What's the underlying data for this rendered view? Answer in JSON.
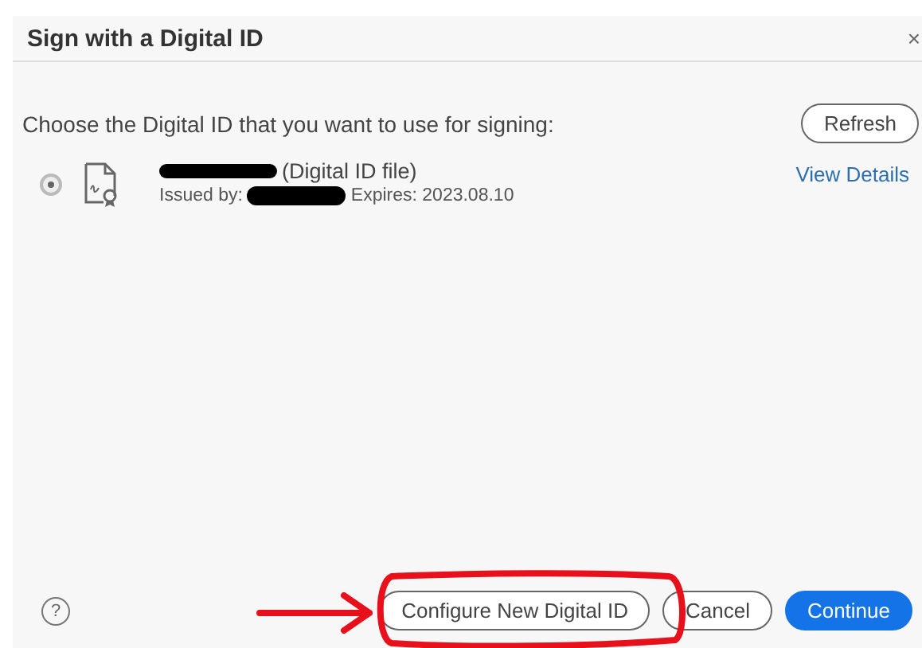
{
  "dialog": {
    "title": "Sign with a Digital ID",
    "close": "×"
  },
  "prompt": "Choose the Digital ID that you want to use for signing:",
  "refresh_button": "Refresh",
  "ids": [
    {
      "selected": true,
      "type_label": "(Digital ID file)",
      "issued_label": "Issued by:",
      "expires": "Expires: 2023.08.10",
      "details_link": "View Details"
    }
  ],
  "footer": {
    "help": "?",
    "buttons": [
      {
        "label": "Configure New Digital ID",
        "kind": "outline"
      },
      {
        "label": "Cancel",
        "kind": "outline"
      },
      {
        "label": "Continue",
        "kind": "primary"
      }
    ]
  }
}
